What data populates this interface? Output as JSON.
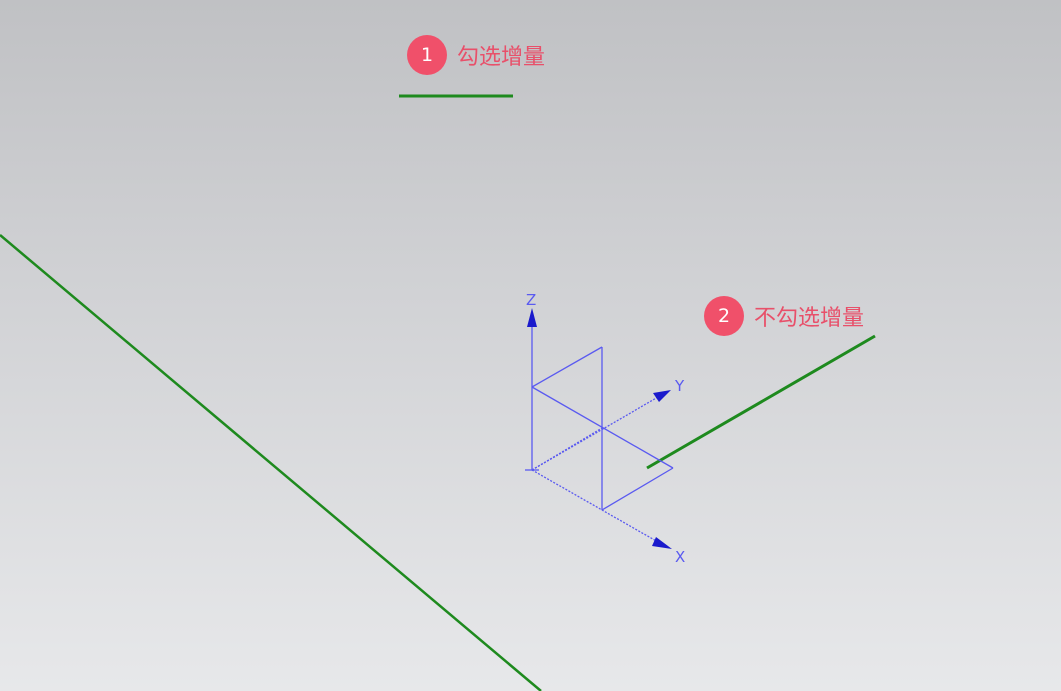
{
  "colors": {
    "curve": "#1e8a1e",
    "csys": "#5a5af0",
    "csys_dark": "#1a1acc",
    "badge": "#f0506a",
    "annotation_text": "#e8506a"
  },
  "annotations": [
    {
      "number": "1",
      "label": "勾选增量"
    },
    {
      "number": "2",
      "label": "不勾选增量"
    }
  ],
  "csys": {
    "x_label": "X",
    "y_label": "Y",
    "z_label": "Z"
  }
}
